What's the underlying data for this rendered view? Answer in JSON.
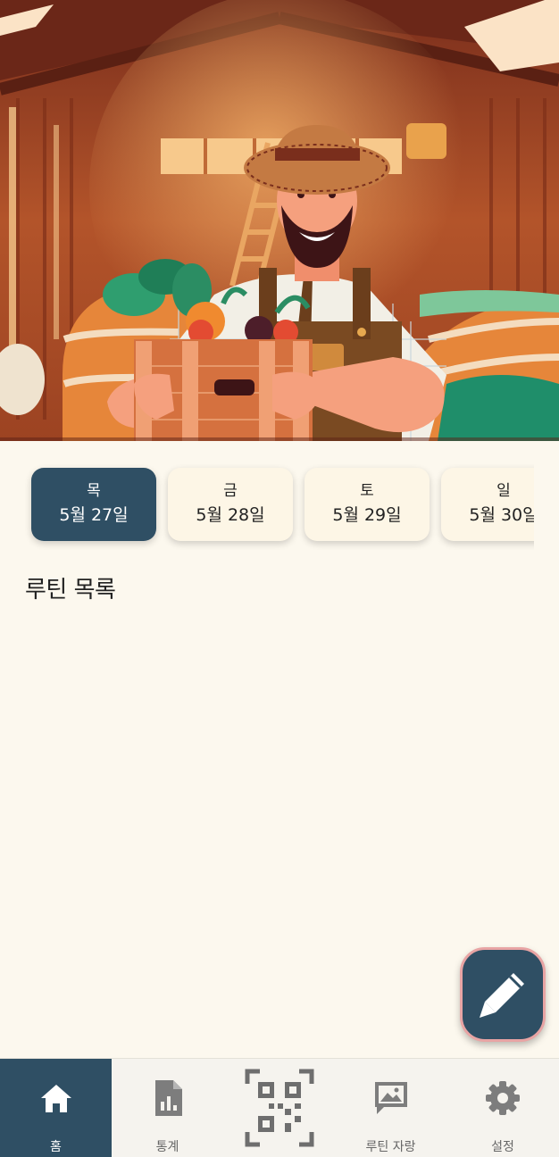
{
  "hero": {
    "icon": "farmer-illustration"
  },
  "dates": [
    {
      "day": "목",
      "date": "5월 27일",
      "selected": true
    },
    {
      "day": "금",
      "date": "5월 28일",
      "selected": false
    },
    {
      "day": "토",
      "date": "5월 29일",
      "selected": false
    },
    {
      "day": "일",
      "date": "5월 30일",
      "selected": false
    }
  ],
  "main": {
    "section_title": "루틴 목록"
  },
  "fab": {
    "icon": "pencil-icon"
  },
  "nav": {
    "items": [
      {
        "label": "홈",
        "icon": "home-icon",
        "active": true
      },
      {
        "label": "통계",
        "icon": "stats-document-icon",
        "active": false
      },
      {
        "label": "",
        "icon": "qr-code-icon",
        "active": false
      },
      {
        "label": "루틴 자랑",
        "icon": "image-gallery-icon",
        "active": false
      },
      {
        "label": "설정",
        "icon": "gear-icon",
        "active": false
      }
    ]
  },
  "colors": {
    "primary": "#2f4f64",
    "background": "#fcf8ee",
    "fab_border": "#e8a4a4"
  }
}
